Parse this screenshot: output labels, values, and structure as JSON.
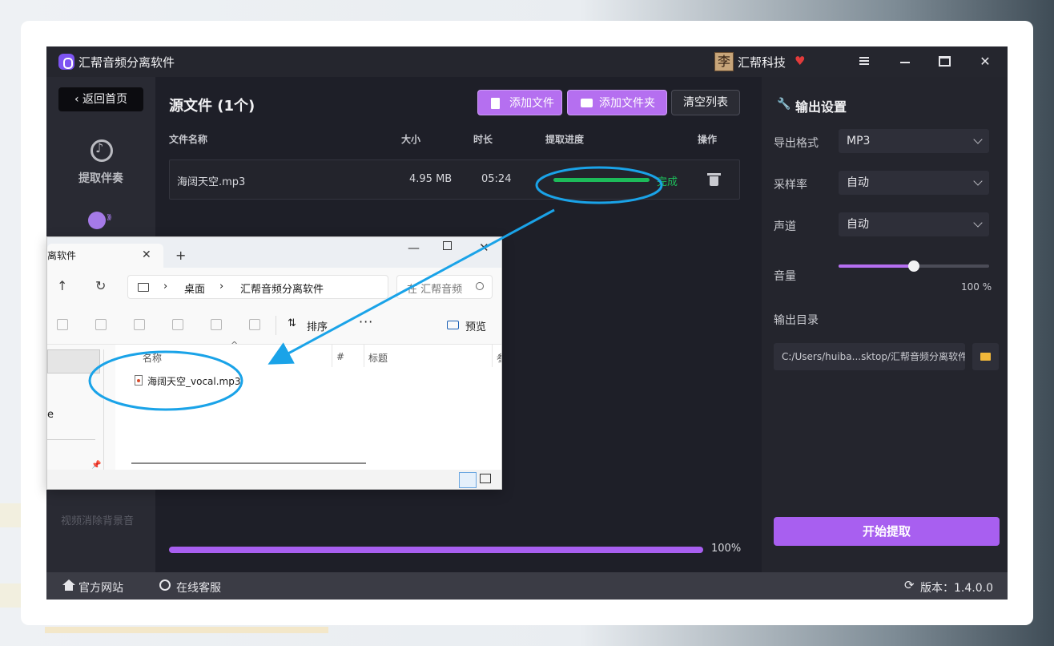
{
  "app": {
    "title": "汇帮音频分离软件",
    "brand_badge": "李",
    "brand_name": "汇帮科技",
    "brand_heart": "♥"
  },
  "sidebar": {
    "back_label": "返回首页",
    "items": [
      {
        "label": "提取伴奏"
      },
      {
        "label": ""
      },
      {
        "label": "视频消除背景音"
      }
    ]
  },
  "main": {
    "source_title": "源文件 (1个)",
    "add_file": "添加文件",
    "add_folder": "添加文件夹",
    "clear_list": "清空列表",
    "columns": {
      "name": "文件名称",
      "size": "大小",
      "duration": "时长",
      "progress": "提取进度",
      "action": "操作"
    },
    "file_row": {
      "name": "海阔天空.mp3",
      "size": "4.95 MB",
      "duration": "05:24",
      "progress_fraction": 1.0,
      "status": "完成"
    },
    "overall_progress_label": "100%",
    "overall_progress_fraction": 1.0
  },
  "settings": {
    "title": "输出设置",
    "format_label": "导出格式",
    "format_value": "MP3",
    "sample_rate_label": "采样率",
    "sample_rate_value": "自动",
    "channel_label": "声道",
    "channel_value": "自动",
    "volume_label": "音量",
    "volume_text": "100 %",
    "volume_fraction": 0.5,
    "output_dir_label": "输出目录",
    "output_dir_value": "C:/Users/huiba...sktop/汇帮音频分离软件",
    "start_button": "开始提取"
  },
  "footer": {
    "website": "官方网站",
    "support": "在线客服",
    "version": "版本：1.4.0.0"
  },
  "explorer": {
    "tab_title": "离软件",
    "tab_close": "✕",
    "tab_add": "+",
    "nav_up": "↑",
    "nav_refresh": "↻",
    "breadcrumb": [
      "桌面",
      "汇帮音频分离软件"
    ],
    "crumb_sep": "›",
    "search_placeholder": "在 汇帮音频",
    "sort_label": "排序",
    "more_label": "···",
    "preview_label": "预览",
    "sidebar_item": "e",
    "columns": {
      "name": "名称",
      "number": "#",
      "title": "标题",
      "extra": "参"
    },
    "files": [
      {
        "name": "海阔天空_vocal.mp3"
      }
    ]
  },
  "colors": {
    "accent_purple": "#b56ff0",
    "success_green": "#1dbb5a",
    "annotation_blue": "#1aa3e8"
  }
}
